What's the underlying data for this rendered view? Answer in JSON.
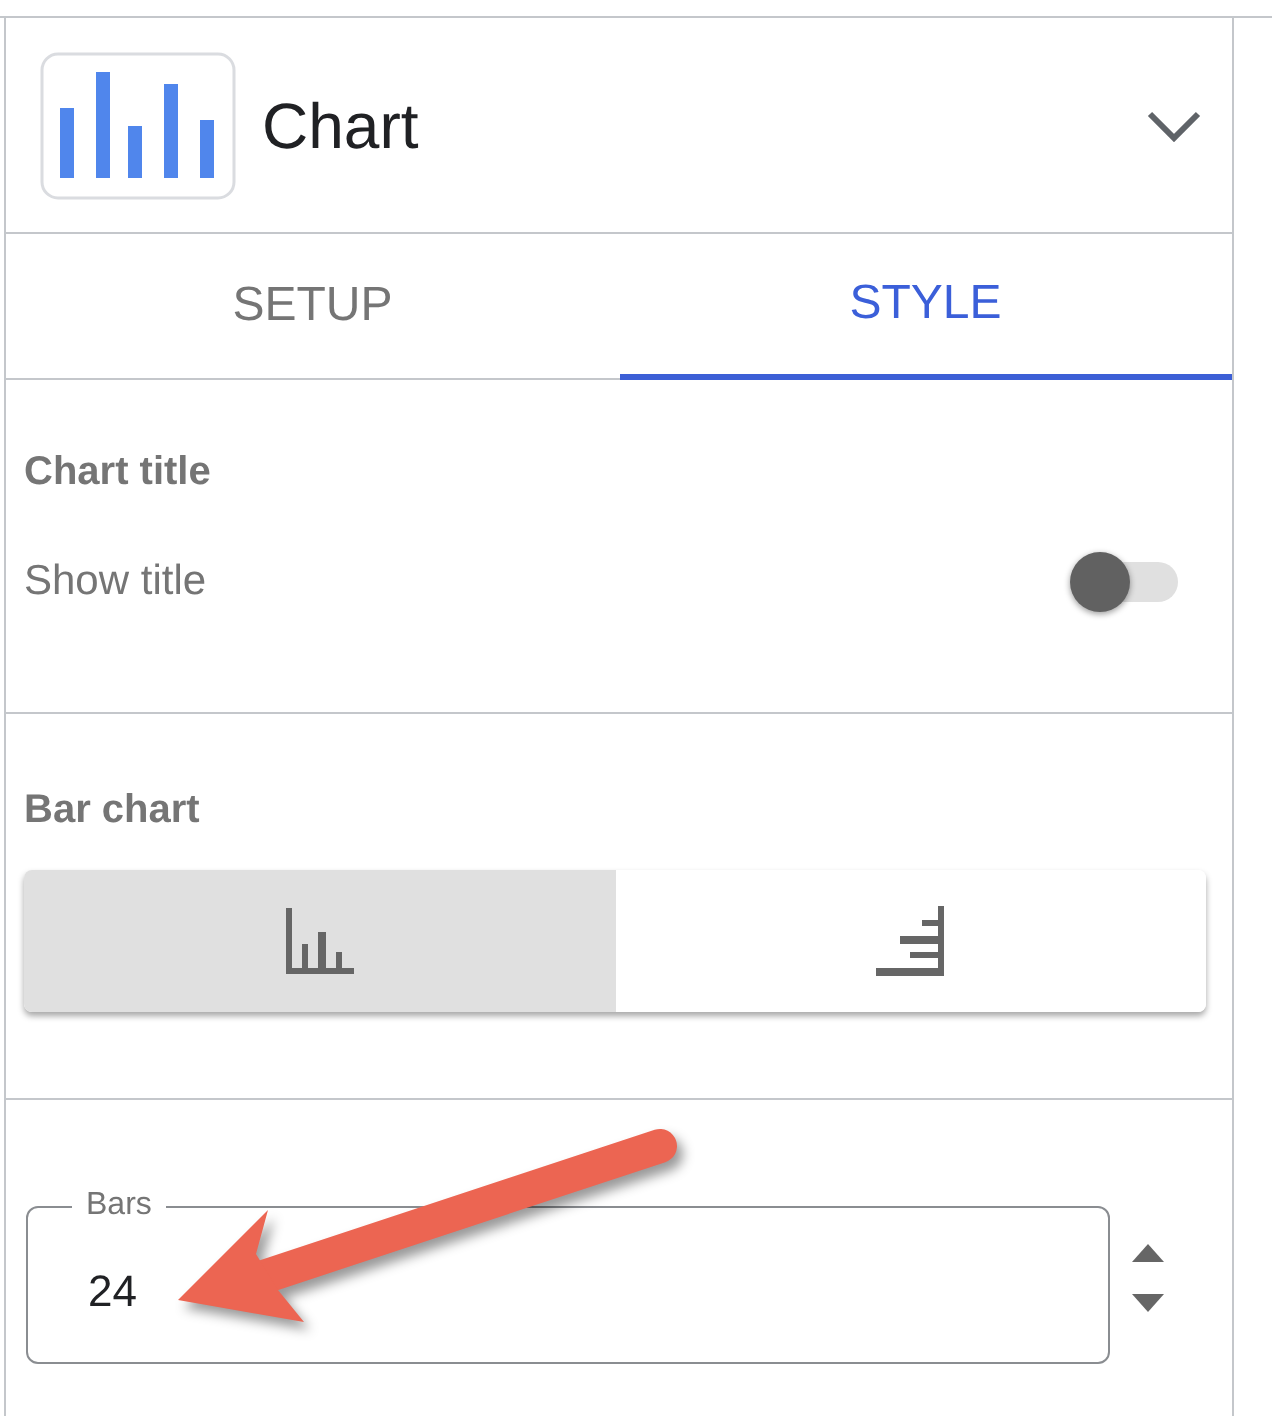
{
  "header": {
    "title": "Chart"
  },
  "tabs": [
    {
      "label": "SETUP",
      "selected": false
    },
    {
      "label": "STYLE",
      "selected": true
    }
  ],
  "sections": [
    {
      "kind": "toggle",
      "heading": "Chart title",
      "label": "Show title",
      "on": false
    },
    {
      "kind": "segmented",
      "heading": "Bar chart",
      "options": [
        {
          "kind": "column",
          "selected": true
        },
        {
          "kind": "bar",
          "selected": false
        }
      ]
    },
    {
      "kind": "number",
      "label": "Bars",
      "value": "24"
    }
  ],
  "annotations": [
    {
      "kind": "arrow"
    }
  ]
}
